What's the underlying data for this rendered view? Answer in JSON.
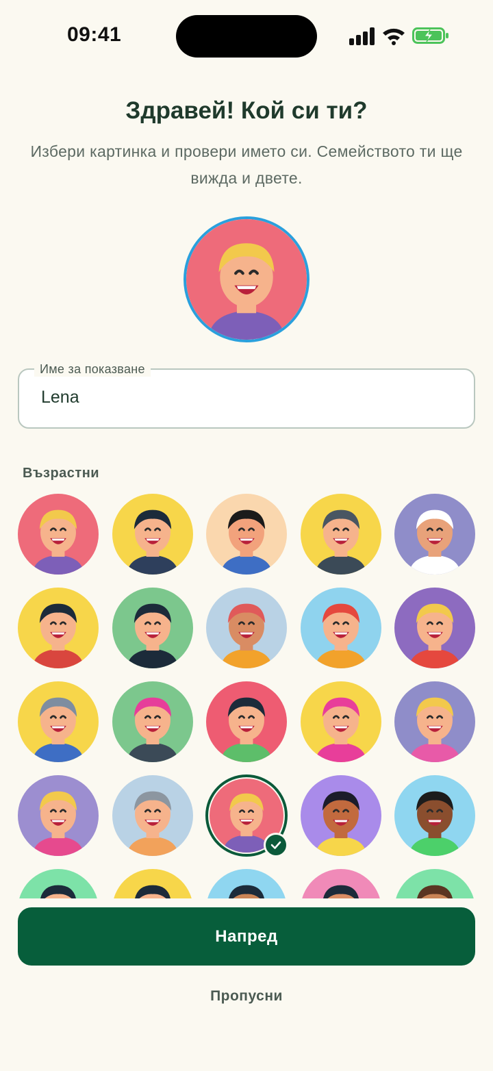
{
  "status_bar": {
    "time": "09:41"
  },
  "header": {
    "title": "Здравей! Кой си ти?",
    "subtitle": "Избери картинка и провери името си. Семейството ти ще вижда и двете."
  },
  "name_field": {
    "label": "Име за показване",
    "value": "Lena"
  },
  "section_label": "Възрастни",
  "avatars": [
    {
      "bg": "#EE6B7A",
      "skin": "#F6B38C",
      "hair": "#F2C94C",
      "shirt": "#7D5FB8"
    },
    {
      "bg": "#F7D64A",
      "skin": "#F6B38C",
      "hair": "#1C2B3A",
      "shirt": "#2E3F5C"
    },
    {
      "bg": "#FAD7AE",
      "skin": "#F2A27C",
      "hair": "#1B1B1B",
      "shirt": "#3E6EC4"
    },
    {
      "bg": "#F7D64A",
      "skin": "#F6B38C",
      "hair": "#4A5662",
      "shirt": "#3B4A57"
    },
    {
      "bg": "#8F8DC9",
      "skin": "#E8A27A",
      "hair": "#FFFFFF",
      "shirt": "#FFFFFF"
    },
    {
      "bg": "#F7D64A",
      "skin": "#F6B38C",
      "hair": "#1C2B3A",
      "shirt": "#D9463E"
    },
    {
      "bg": "#7CC78D",
      "skin": "#F6B38C",
      "hair": "#1C2B3A",
      "shirt": "#1C2B3A"
    },
    {
      "bg": "#B9D2E5",
      "skin": "#D98C63",
      "hair": "#E05A5A",
      "shirt": "#F2A22B"
    },
    {
      "bg": "#8FD3EE",
      "skin": "#F6B38C",
      "hair": "#E5483E",
      "shirt": "#F2A22B"
    },
    {
      "bg": "#8D6BC0",
      "skin": "#F6B38C",
      "hair": "#F2C94C",
      "shirt": "#E5483E"
    },
    {
      "bg": "#F7D64A",
      "skin": "#F6B38C",
      "hair": "#7E8DA0",
      "shirt": "#3E6EC4"
    },
    {
      "bg": "#7CC78D",
      "skin": "#F6B38C",
      "hair": "#E63E9A",
      "shirt": "#3B4A57"
    },
    {
      "bg": "#EE5C72",
      "skin": "#F6B38C",
      "hair": "#1C2B3A",
      "shirt": "#5DBE6A"
    },
    {
      "bg": "#F7D64A",
      "skin": "#F6B38C",
      "hair": "#E83E9A",
      "shirt": "#E83E9A"
    },
    {
      "bg": "#8F8DC9",
      "skin": "#F6B38C",
      "hair": "#F2C94C",
      "shirt": "#E85AA8"
    },
    {
      "bg": "#9C8ED0",
      "skin": "#F6B38C",
      "hair": "#F2C94C",
      "shirt": "#E64A8E"
    },
    {
      "bg": "#B9D2E5",
      "skin": "#F6B38C",
      "hair": "#8C96A0",
      "shirt": "#F2A25B"
    },
    {
      "bg": "#EE6B7A",
      "skin": "#F6B38C",
      "hair": "#F2C94C",
      "shirt": "#7D5FB8"
    },
    {
      "bg": "#A98BEA",
      "skin": "#C26A3E",
      "hair": "#1C1C2A",
      "shirt": "#F7D64A"
    },
    {
      "bg": "#8FD6F0",
      "skin": "#8A4E2E",
      "hair": "#1C1C1C",
      "shirt": "#4CD06A"
    },
    {
      "bg": "#7DE2A8",
      "skin": "#F6B38C",
      "hair": "#1C2B3A",
      "shirt": "#3B4A57"
    },
    {
      "bg": "#F7D64A",
      "skin": "#F6B38C",
      "hair": "#1C2B3A",
      "shirt": "#3B4A57"
    },
    {
      "bg": "#8FD6F0",
      "skin": "#C98456",
      "hair": "#1C2B3A",
      "shirt": "#3B4A57"
    },
    {
      "bg": "#F08AB8",
      "skin": "#D98C63",
      "hair": "#1C2B3A",
      "shirt": "#3B4A57"
    },
    {
      "bg": "#7DE2A8",
      "skin": "#C98456",
      "hair": "#5A3522",
      "shirt": "#3B4A57"
    }
  ],
  "selected_index": 17,
  "actions": {
    "primary": "Напред",
    "skip": "Пропусни"
  },
  "colors": {
    "accent": "#075E3B",
    "selection_ring": "#2AA0DD"
  }
}
